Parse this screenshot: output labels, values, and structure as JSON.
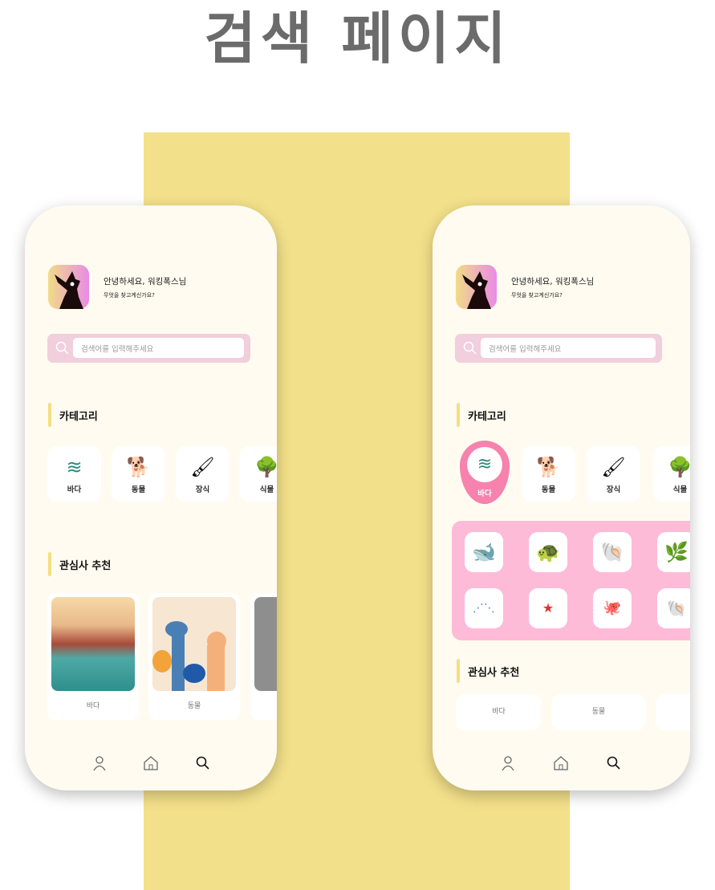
{
  "title": "검색 페이지",
  "greeting": "안녕하세요, 워킹폭스님",
  "subtitle": "무엇을 찾고계신가요?",
  "search_placeholder": "검색어를 입력해주세요",
  "category_heading": "카테고리",
  "recommend_heading": "관심사 추천",
  "categories": [
    {
      "label": "바다",
      "icon": "wave-icon"
    },
    {
      "label": "동물",
      "icon": "dog-icon"
    },
    {
      "label": "장식",
      "icon": "paint-icon"
    },
    {
      "label": "식물",
      "icon": "tree-icon"
    }
  ],
  "sea_items": [
    "whale-icon",
    "turtle-icon",
    "shell-icon",
    "seaweed-icon",
    "fish-school-icon",
    "starfish-icon",
    "octopus-icon",
    "scallop-icon"
  ],
  "recommend": [
    {
      "label": "바다"
    },
    {
      "label": "동물"
    }
  ],
  "colors": {
    "accent_pink": "#f682ad",
    "panel_pink": "#fdbbd8",
    "yellow": "#f3e08a"
  }
}
